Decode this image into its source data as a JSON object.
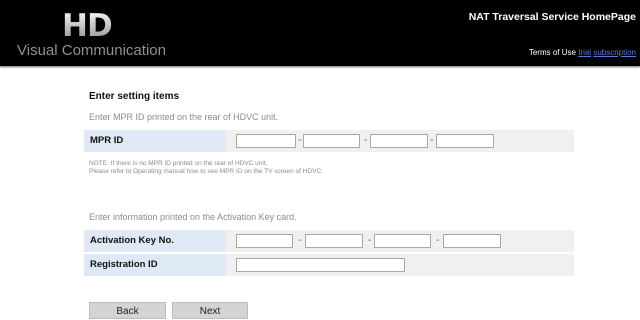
{
  "header": {
    "logo_mark": "HD",
    "logo_subtitle": "Visual Communication",
    "title": "NAT Traversal Service HomePage",
    "links_prefix": "Terms of Use",
    "link_trial": "trial",
    "link_subscription": "subscription"
  },
  "form": {
    "section_title": "Enter setting items",
    "mpr_hint": "Enter MPR ID printed on the rear of HDVC unit.",
    "mpr_label": "MPR ID",
    "mpr_separator": "-",
    "note_line1": "NOTE:  If there is no MPR ID printed on the rear of HDVC unit,",
    "note_line2": "Please refer to Operating manual how to see MPR ID on the TV screen of HDVC.",
    "activation_hint": "Enter information printed on the Activation Key card.",
    "activation_label": "Activation Key No.",
    "registration_label": "Registration ID",
    "mpr_fields": [
      "",
      "",
      "",
      ""
    ],
    "activation_fields": [
      "",
      "",
      "",
      ""
    ],
    "registration_value": ""
  },
  "buttons": {
    "back": "Back",
    "next": "Next"
  }
}
